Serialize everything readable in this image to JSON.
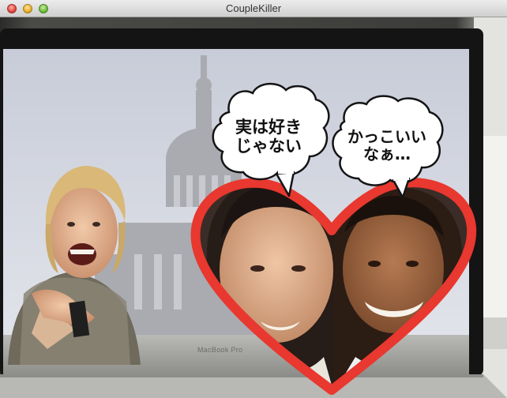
{
  "window": {
    "title": "CoupleKiller",
    "controls": [
      "close",
      "minimize",
      "zoom"
    ]
  },
  "camera": {
    "laptop_brand": "MacBook Pro"
  },
  "overlay": {
    "frame_shape": "heart",
    "frame_color": "#e8382f",
    "bubbles": [
      {
        "id": "left",
        "text": "実は好き\nじゃない"
      },
      {
        "id": "right",
        "text": "かっこいい\nなぁ…"
      }
    ]
  }
}
